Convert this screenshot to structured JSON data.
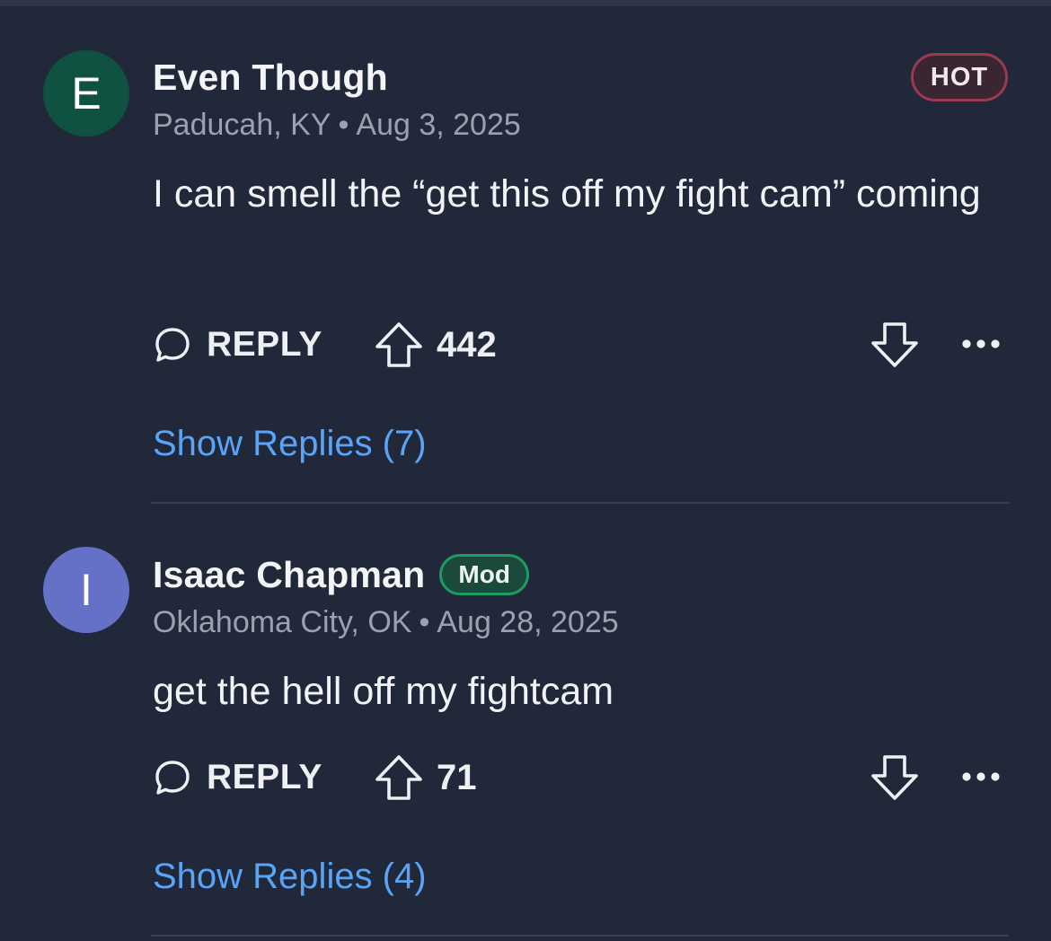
{
  "comments": [
    {
      "avatar_letter": "E",
      "avatar_color": "#0f5241",
      "author": "Even Though",
      "badge": "HOT",
      "location": "Paducah, KY",
      "separator": "•",
      "date": "Aug 3, 2025",
      "body": "I can smell the “get this off my fight cam” coming",
      "reply_label": "REPLY",
      "votes": "442",
      "show_replies": "Show Replies (7)"
    },
    {
      "avatar_letter": "I",
      "avatar_color": "#6471c6",
      "author": "Isaac Chapman",
      "badge": "Mod",
      "location": "Oklahoma City, OK",
      "separator": "•",
      "date": "Aug 28, 2025",
      "body": "get the hell off my fightcam",
      "reply_label": "REPLY",
      "votes": "71",
      "show_replies": "Show Replies (4)"
    }
  ],
  "icons": {
    "reply": "speech-bubble-icon",
    "upvote": "arrow-up-icon",
    "downvote": "arrow-down-icon",
    "more": "ellipsis-icon"
  },
  "colors": {
    "background": "#212839",
    "link": "#5aa4f8",
    "hot_badge_border": "#9a3a50",
    "mod_badge_border": "#1d9a62"
  }
}
